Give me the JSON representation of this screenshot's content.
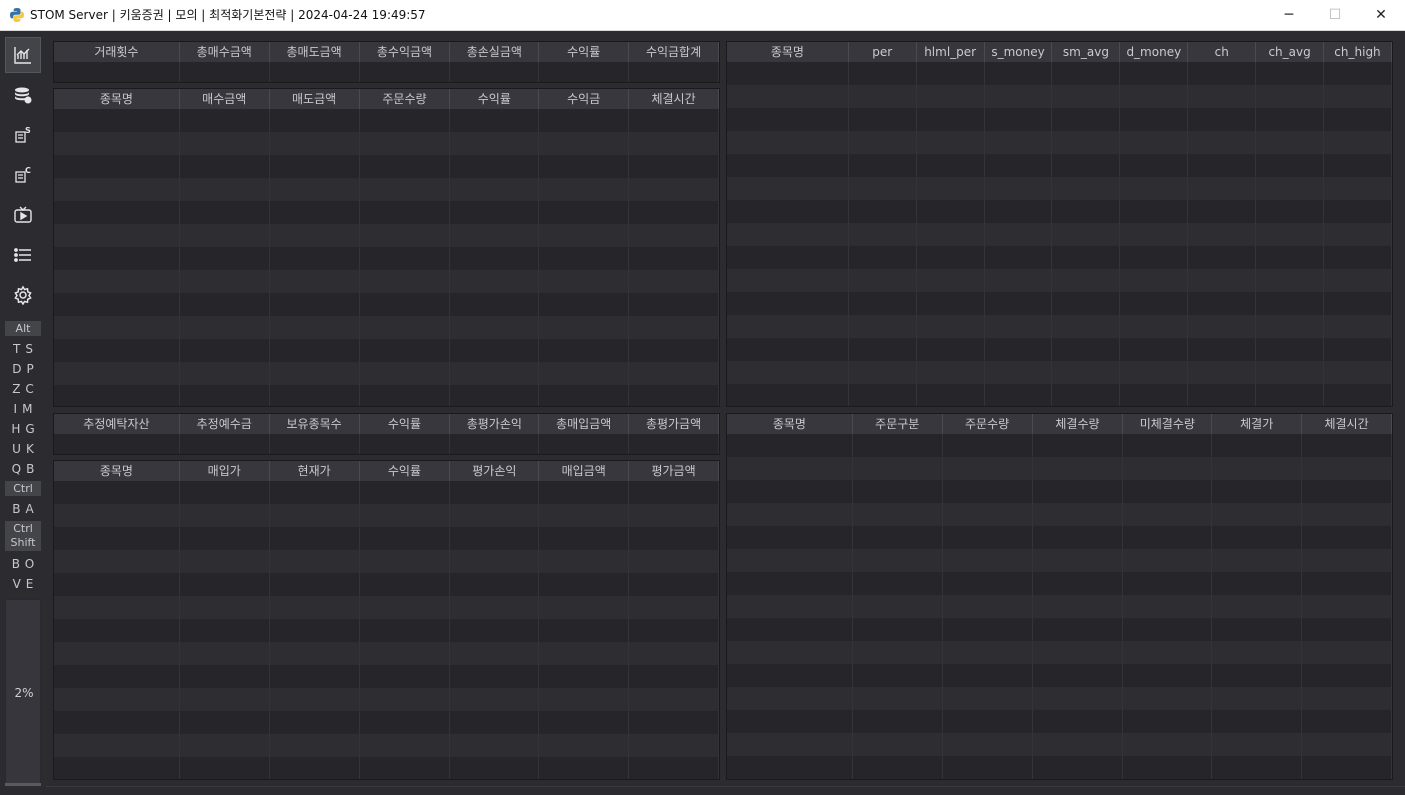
{
  "window": {
    "title": "STOM Server | 키움증권 | 모의 | 최적화기본전략 | 2024-04-24 19:49:57",
    "minimize_glyph": "─",
    "maximize_glyph": "☐",
    "close_glyph": "✕"
  },
  "sidebar": {
    "buttons": [
      {
        "name": "chart-icon"
      },
      {
        "name": "database-coins-icon"
      },
      {
        "name": "stock-s-icon"
      },
      {
        "name": "coin-c-icon"
      },
      {
        "name": "tv-play-icon"
      },
      {
        "name": "list-icon"
      },
      {
        "name": "gear-icon"
      }
    ],
    "alt_label": "Alt",
    "alt_rows": [
      "TS",
      "DP",
      "ZC",
      "IM",
      "HG",
      "UK",
      "QB"
    ],
    "ctrl_label": "Ctrl",
    "ctrl_rows": [
      "BA"
    ],
    "ctrl_shift_label_1": "Ctrl",
    "ctrl_shift_label_2": "Shift",
    "ctrl_shift_rows": [
      "BO",
      "VE"
    ],
    "cpu_text": "2%"
  },
  "tables": {
    "stock_summary": {
      "columns": [
        "거래횟수",
        "총매수금액",
        "총매도금액",
        "총수익금액",
        "총손실금액",
        "수익률",
        "수익금합계"
      ]
    },
    "stock_trades": {
      "columns": [
        "종목명",
        "매수금액",
        "매도금액",
        "주문수량",
        "수익률",
        "수익금",
        "체결시간"
      ]
    },
    "stock_gsjm": {
      "columns": [
        "종목명",
        "per",
        "hlml_per",
        "s_money",
        "sm_avg",
        "d_money",
        "ch",
        "ch_avg",
        "ch_high"
      ]
    },
    "stock_balance": {
      "columns": [
        "추정예탁자산",
        "추정예수금",
        "보유종목수",
        "수익률",
        "총평가손익",
        "총매입금액",
        "총평가금액"
      ]
    },
    "stock_holdings": {
      "columns": [
        "종목명",
        "매입가",
        "현재가",
        "수익률",
        "평가손익",
        "매입금액",
        "평가금액"
      ]
    },
    "stock_orders": {
      "columns": [
        "종목명",
        "주문구분",
        "주문수량",
        "체결수량",
        "미체결수량",
        "체결가",
        "체결시간"
      ]
    }
  }
}
